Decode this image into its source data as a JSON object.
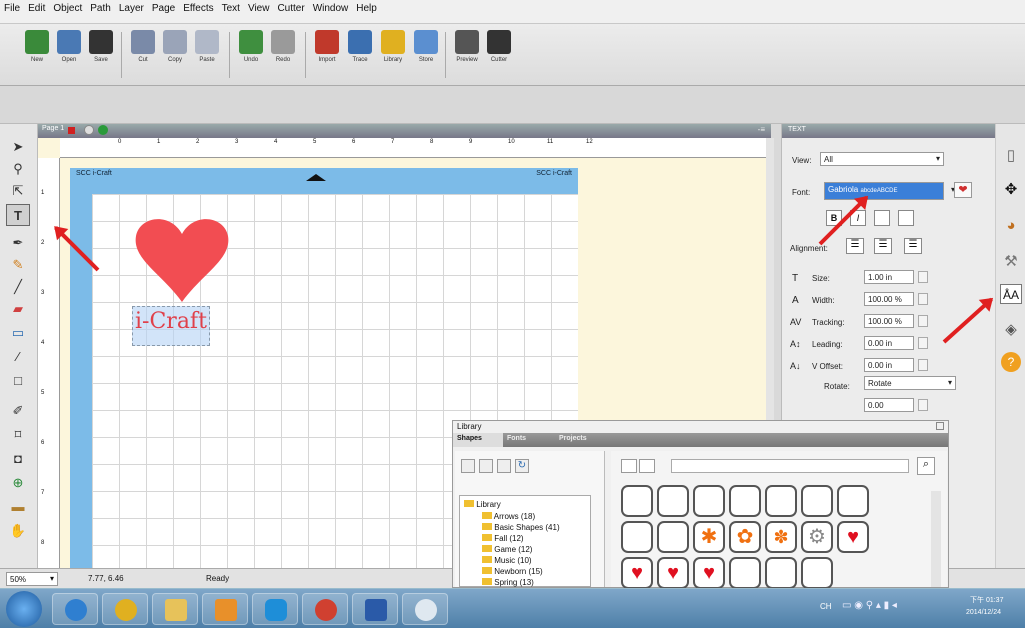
{
  "menu": [
    "File",
    "Edit",
    "Object",
    "Path",
    "Layer",
    "Page",
    "Effects",
    "Text",
    "View",
    "Cutter",
    "Window",
    "Help"
  ],
  "toolbar": [
    {
      "label": "New",
      "icon": "new-icon",
      "color": "#3a8a3a"
    },
    {
      "label": "Open",
      "icon": "open-icon",
      "color": "#4a79b4"
    },
    {
      "label": "Save",
      "icon": "save-icon",
      "color": "#333333"
    },
    {
      "label": "Cut",
      "icon": "cut-icon",
      "color": "#7a8aa8"
    },
    {
      "label": "Copy",
      "icon": "copy-icon",
      "color": "#9aa4b8"
    },
    {
      "label": "Paste",
      "icon": "paste-icon",
      "color": "#b0b8c8"
    },
    {
      "label": "Undo",
      "icon": "undo-icon",
      "color": "#3f8f3f"
    },
    {
      "label": "Redo",
      "icon": "redo-icon",
      "color": "#9a9a9a"
    },
    {
      "label": "Import",
      "icon": "import-icon",
      "color": "#c0392b"
    },
    {
      "label": "Trace",
      "icon": "trace-icon",
      "color": "#3b6fb0"
    },
    {
      "label": "Library",
      "icon": "library-icon",
      "color": "#e0b020"
    },
    {
      "label": "Store",
      "icon": "store-icon",
      "color": "#5b8fd0"
    },
    {
      "label": "Preview",
      "icon": "preview-icon",
      "color": "#555555"
    },
    {
      "label": "Cutter",
      "icon": "cutter-icon",
      "color": "#333333"
    }
  ],
  "page_tab": {
    "label": "Page 1"
  },
  "mat_label_left": "SCC i-Craft",
  "mat_label_right": "SCC i-Craft",
  "canvas_text": "i-Craft",
  "ruler_top": [
    "0",
    "1",
    "2",
    "3",
    "4",
    "5",
    "6",
    "7",
    "8",
    "9",
    "10",
    "11",
    "12"
  ],
  "ruler_left": [
    "1",
    "2",
    "3",
    "4",
    "5",
    "6",
    "7",
    "8"
  ],
  "status": {
    "zoom": "50%",
    "coords": "7.77, 6.46",
    "state": "Ready"
  },
  "text_panel": {
    "title": "TEXT",
    "view_label": "View:",
    "view_value": "All",
    "font_label": "Font:",
    "font_value": "Gabriola",
    "font_preview": "abcdeABCDE",
    "alignment_label": "Alignment:",
    "size_label": "Size:",
    "size_value": "1.00 in",
    "width_label": "Width:",
    "width_value": "100.00 %",
    "tracking_label": "Tracking:",
    "tracking_value": "100.00 %",
    "leading_label": "Leading:",
    "leading_value": "0.00 in",
    "voffset_label": "V Offset:",
    "voffset_value": "0.00 in",
    "rotate_label": "Rotate:",
    "rotate_value": "Rotate",
    "rotate_amount": "0.00",
    "style_buttons": [
      "B",
      "I"
    ]
  },
  "library": {
    "title": "Library",
    "tabs": [
      "Shapes",
      "Fonts",
      "Projects"
    ],
    "tree": [
      {
        "label": "Library"
      },
      {
        "label": "Arrows (18)"
      },
      {
        "label": "Basic Shapes (41)"
      },
      {
        "label": "Fall (12)"
      },
      {
        "label": "Game (12)"
      },
      {
        "label": "Music (10)"
      },
      {
        "label": "Newborn (15)"
      },
      {
        "label": "Spring (13)"
      }
    ]
  },
  "taskbar": {
    "apps": [
      {
        "name": "ie",
        "color": "#2f7fd0"
      },
      {
        "name": "chrome",
        "color": "#e0b020"
      },
      {
        "name": "explorer",
        "color": "#e7c25a"
      },
      {
        "name": "outlook",
        "color": "#e8902a"
      },
      {
        "name": "skype",
        "color": "#1e8ed8"
      },
      {
        "name": "chrome2",
        "color": "#d04030"
      },
      {
        "name": "word",
        "color": "#2a5aa8"
      },
      {
        "name": "app",
        "color": "#dfe8f0"
      }
    ],
    "lang": "CH",
    "time": "下午 01:37",
    "date": "2014/12/24"
  }
}
